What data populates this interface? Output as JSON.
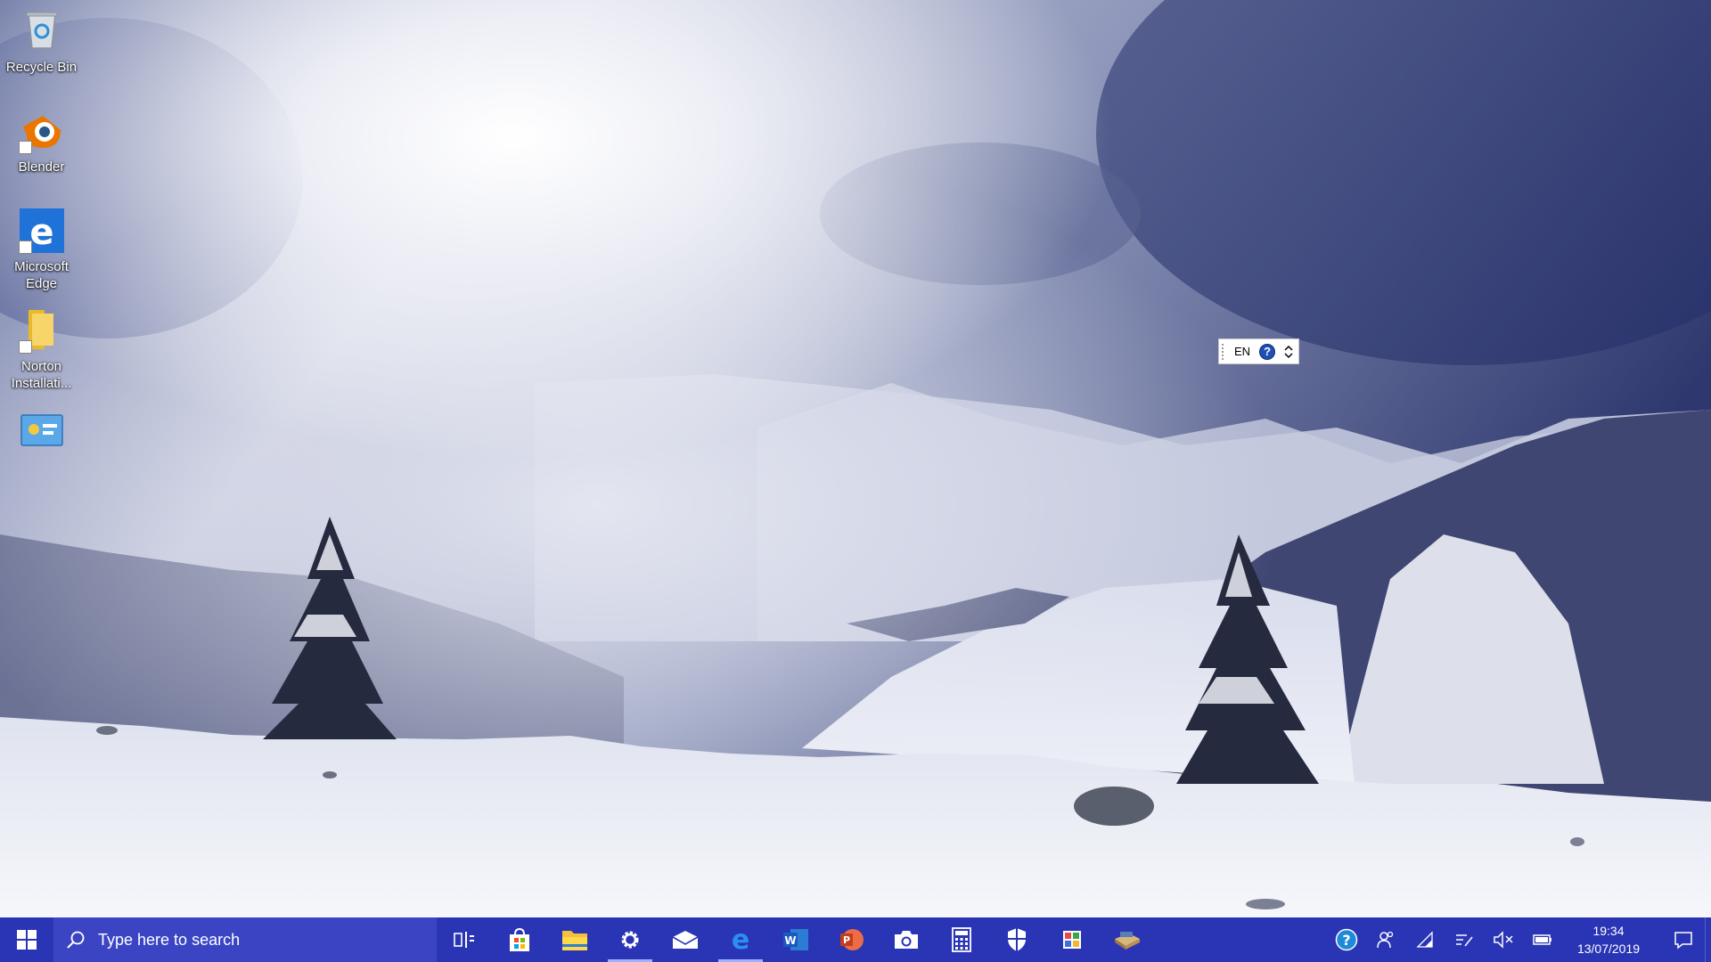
{
  "desktop": {
    "icons": [
      {
        "label": "Recycle Bin",
        "icon": "recycle-bin-icon"
      },
      {
        "label": "Blender",
        "icon": "blender-icon"
      },
      {
        "label": "Microsoft Edge",
        "icon": "edge-icon"
      },
      {
        "label": "Norton Installati...",
        "icon": "folder-icon"
      },
      {
        "label": "",
        "icon": "control-panel-icon"
      }
    ]
  },
  "language_bar": {
    "language": "EN",
    "help_glyph": "?"
  },
  "taskbar": {
    "search_placeholder": "Type here to search",
    "pinned_apps": [
      {
        "name": "task-view",
        "icon": "task-view-icon"
      },
      {
        "name": "microsoft-store",
        "icon": "store-icon"
      },
      {
        "name": "file-explorer",
        "icon": "folder-icon"
      },
      {
        "name": "settings",
        "icon": "gear-icon",
        "active": true
      },
      {
        "name": "mail",
        "icon": "mail-icon"
      },
      {
        "name": "microsoft-edge",
        "icon": "edge-icon",
        "active": true
      },
      {
        "name": "word",
        "icon": "word-icon",
        "letter": "W"
      },
      {
        "name": "powerpoint",
        "icon": "powerpoint-icon",
        "letter": "P"
      },
      {
        "name": "camera",
        "icon": "camera-icon"
      },
      {
        "name": "calculator",
        "icon": "calculator-icon"
      },
      {
        "name": "windows-security",
        "icon": "shield-icon"
      },
      {
        "name": "photos-app",
        "icon": "paint-icon"
      },
      {
        "name": "file-manager",
        "icon": "file-manager-icon"
      }
    ],
    "tray": {
      "help_glyph": "?",
      "time": "19:34",
      "date": "13/07/2019"
    }
  },
  "colors": {
    "taskbar": "#2a35b5",
    "searchbox": "#3b45c4",
    "accent": "#9fb0ff"
  }
}
